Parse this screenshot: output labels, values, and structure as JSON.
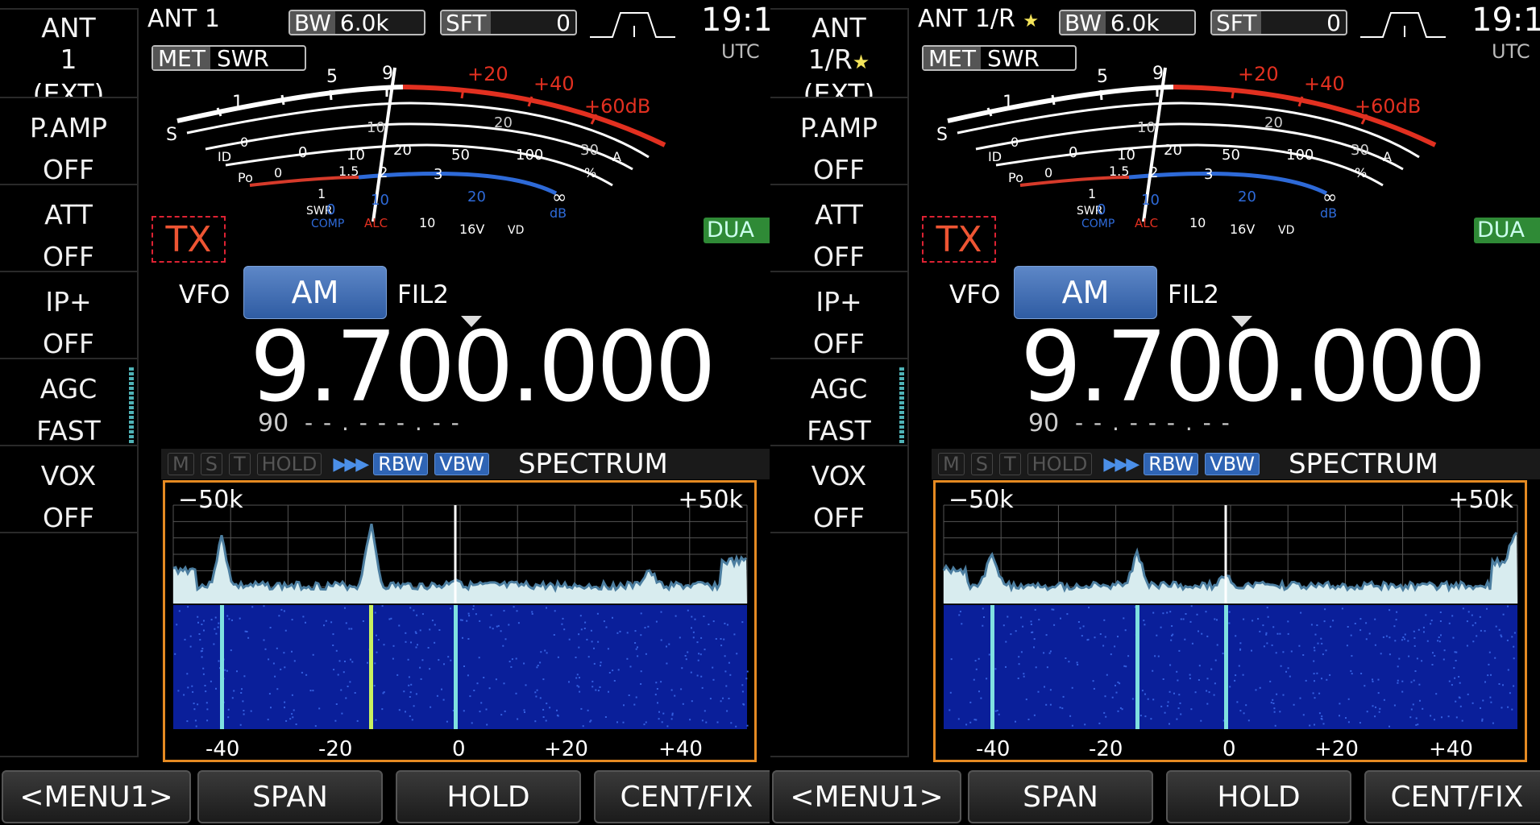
{
  "panels": [
    {
      "ant": {
        "label": "ANT 1",
        "star": ""
      },
      "keys": {
        "ant": {
          "l1": "ANT",
          "l2": "1",
          "l3": "(EXT)",
          "star": ""
        },
        "pamp": {
          "l1": "P.AMP",
          "l2": "OFF"
        },
        "att": {
          "l1": "ATT",
          "l2": "OFF"
        },
        "ipp": {
          "l1": "IP+",
          "l2": "OFF"
        },
        "agc": {
          "l1": "AGC",
          "l2": "FAST"
        },
        "vox": {
          "l1": "VOX",
          "l2": "OFF"
        }
      },
      "bw": {
        "k": "BW",
        "v": "6.0k"
      },
      "sft": {
        "k": "SFT",
        "v": "0"
      },
      "clock": "19:1",
      "utc": "UTC",
      "met": {
        "k": "MET",
        "v": "SWR"
      },
      "tx": "TX",
      "dual": "DUA",
      "vfo": "VFO",
      "mode": "AM",
      "fil": "FIL2",
      "freq": "9.700.000",
      "sub_num": "90",
      "sub_dash": "- - . - - - . - -",
      "spectrum": {
        "tags": [
          "M",
          "S",
          "T",
          "HOLD",
          "RBW",
          "VBW"
        ],
        "arrows": "▶▶▶",
        "title": "SPECTRUM",
        "left": "−50k",
        "right": "+50k",
        "xticks": [
          "-40",
          "-20",
          "0",
          "+20",
          "+40"
        ]
      },
      "softkeys": [
        "<MENU1>",
        "SPAN",
        "HOLD",
        "CENT/FIX"
      ]
    },
    {
      "ant": {
        "label": "ANT 1/R",
        "star": "★"
      },
      "keys": {
        "ant": {
          "l1": "ANT",
          "l2": "1/R",
          "l3": "(EXT)",
          "star": "★"
        },
        "pamp": {
          "l1": "P.AMP",
          "l2": "OFF"
        },
        "att": {
          "l1": "ATT",
          "l2": "OFF"
        },
        "ipp": {
          "l1": "IP+",
          "l2": "OFF"
        },
        "agc": {
          "l1": "AGC",
          "l2": "FAST"
        },
        "vox": {
          "l1": "VOX",
          "l2": "OFF"
        }
      },
      "bw": {
        "k": "BW",
        "v": "6.0k"
      },
      "sft": {
        "k": "SFT",
        "v": "0"
      },
      "clock": "19:1",
      "utc": "UTC",
      "met": {
        "k": "MET",
        "v": "SWR"
      },
      "tx": "TX",
      "dual": "DUA",
      "vfo": "VFO",
      "mode": "AM",
      "fil": "FIL2",
      "freq": "9.700.000",
      "sub_num": "90",
      "sub_dash": "- - . - - - . - -",
      "spectrum": {
        "tags": [
          "M",
          "S",
          "T",
          "HOLD",
          "RBW",
          "VBW"
        ],
        "arrows": "▶▶▶",
        "title": "SPECTRUM",
        "left": "−50k",
        "right": "+50k",
        "xticks": [
          "-40",
          "-20",
          "0",
          "+20",
          "+40"
        ]
      },
      "softkeys": [
        "<MENU1>",
        "SPAN",
        "HOLD",
        "CENT/FIX"
      ]
    }
  ],
  "meter": {
    "s_scale": [
      "S",
      "1",
      "5",
      "9",
      "+20",
      "+40",
      "+60dB"
    ],
    "id_scale": [
      "ID",
      "0",
      "10",
      "20",
      "A"
    ],
    "po_scale": [
      "Po",
      "0",
      "50",
      "100",
      "%"
    ],
    "swr_scale": [
      "SWR",
      "1",
      "1.5",
      "2",
      "3",
      "∞"
    ],
    "comp_scale": [
      "COMP",
      "0",
      "10",
      "20",
      "dB"
    ],
    "alc_label": "ALC",
    "vd_scale": [
      "10",
      "16V",
      "VD"
    ],
    "id_extra": [
      "0",
      "10",
      "20",
      "30"
    ]
  },
  "colors": {
    "accent_blue": "#2f64b4",
    "spectrum_border": "#e58a22",
    "tx_red": "#e53333",
    "dual_green": "#2f8a36",
    "meter_red": "#e23020",
    "meter_blue": "#2e6ad8"
  }
}
